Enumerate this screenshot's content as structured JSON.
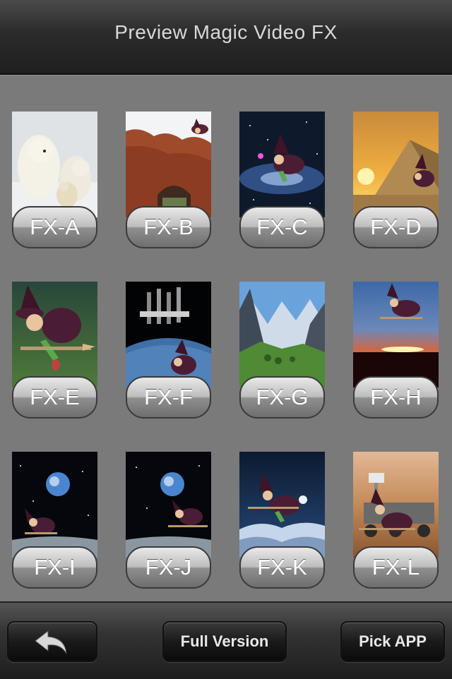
{
  "navbar": {
    "title": "Preview Magic Video FX"
  },
  "effects": [
    {
      "label": "FX-A",
      "scene": "polar-bears"
    },
    {
      "label": "FX-B",
      "scene": "rock-arch-witch"
    },
    {
      "label": "FX-C",
      "scene": "galaxy-witch"
    },
    {
      "label": "FX-D",
      "scene": "pyramids-witch"
    },
    {
      "label": "FX-E",
      "scene": "witch-closeup"
    },
    {
      "label": "FX-F",
      "scene": "space-station-witch"
    },
    {
      "label": "FX-G",
      "scene": "mountain-valley"
    },
    {
      "label": "FX-H",
      "scene": "sunset-witch"
    },
    {
      "label": "FX-I",
      "scene": "earthrise-witch"
    },
    {
      "label": "FX-J",
      "scene": "earthrise-witch-2"
    },
    {
      "label": "FX-K",
      "scene": "night-sea-witch"
    },
    {
      "label": "FX-L",
      "scene": "mars-rover-witch"
    }
  ],
  "toolbar": {
    "back_icon": "back-arrow-icon",
    "full_version_label": "Full Version",
    "pick_app_label": "Pick APP"
  }
}
